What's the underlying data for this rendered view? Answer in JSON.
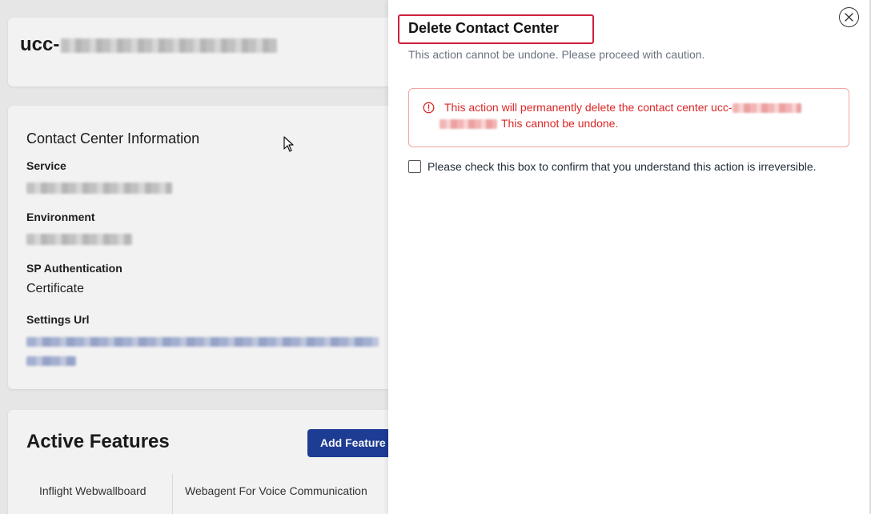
{
  "page": {
    "title_prefix": "ucc-",
    "info_card": {
      "heading": "Contact Center Information",
      "fields": [
        {
          "label": "Service"
        },
        {
          "label": "Environment"
        },
        {
          "label": "SP Authentication",
          "value": "Certificate"
        },
        {
          "label": "Settings Url"
        }
      ]
    },
    "features": {
      "heading": "Active Features",
      "add_button": "Add Feature",
      "tabs": [
        "Inflight Webwallboard",
        "Webagent For Voice Communication"
      ]
    }
  },
  "drawer": {
    "title": "Delete Contact Center",
    "subtitle": "This action cannot be undone. Please proceed with caution.",
    "close_icon": "close-circle-icon",
    "alert": {
      "icon": "alert-circle-icon",
      "line1_prefix": "This action will permanently delete the contact center ucc-",
      "line2_suffix": "This cannot be undone.",
      "color": "#dc2626"
    },
    "confirm_checkbox": {
      "checked": false,
      "label": "Please check this box to confirm that you understand this action is irreversible."
    },
    "accent": "#d21f3c"
  }
}
